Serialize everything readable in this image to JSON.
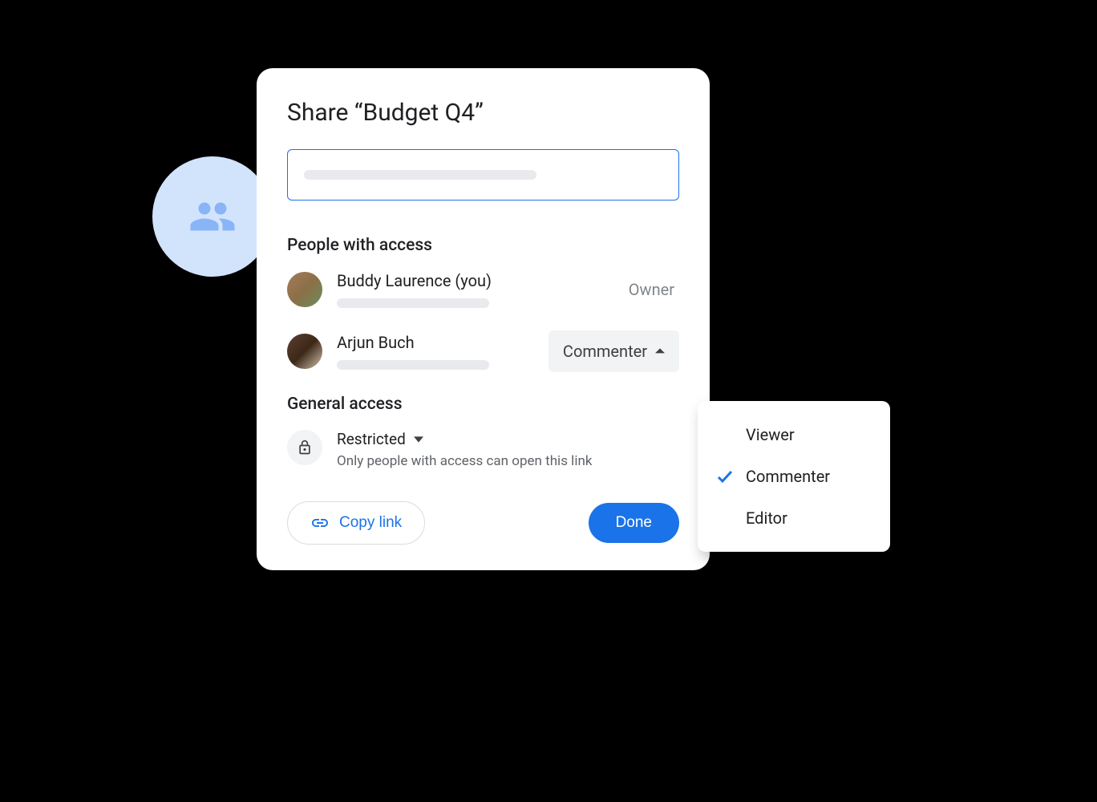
{
  "dialog": {
    "title": "Share “Budget Q4”",
    "sections": {
      "people_heading": "People with access",
      "general_heading": "General access"
    },
    "people": [
      {
        "name": "Buddy Laurence (you)",
        "role": "Owner"
      },
      {
        "name": "Arjun Buch",
        "role": "Commenter"
      }
    ],
    "general": {
      "mode": "Restricted",
      "description": "Only people with access can open this link"
    },
    "footer": {
      "copy_link": "Copy link",
      "done": "Done"
    }
  },
  "role_menu": {
    "options": [
      "Viewer",
      "Commenter",
      "Editor"
    ],
    "selected": "Commenter"
  }
}
